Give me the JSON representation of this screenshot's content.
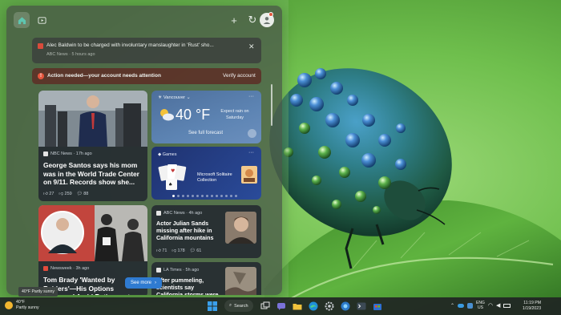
{
  "panel": {
    "notifications": [
      {
        "text": "Alec Baldwin to be charged with involuntary manslaughter in 'Rust' sho...",
        "source": "ABC News · 5 hours ago"
      },
      {
        "text": "Action needed—your account needs attention",
        "action": "Verify account"
      }
    ],
    "cards": {
      "santos": {
        "source": "NBC News · 17h ago",
        "headline": "George Santos says his mom was in the World Trade Center on 9/11. Records show she...",
        "likes": "27",
        "dislikes": "259",
        "comments": "88"
      },
      "brady": {
        "source": "Newsweek · 3h ago",
        "headline": "Tom Brady 'Wanted by Raiders'—His Options Assessed Amid Retirement Rumors"
      },
      "weather": {
        "city": "Vancouver",
        "temp": "40 °F",
        "desc": "Expect rain on Saturday",
        "link": "See full forecast"
      },
      "games": {
        "title": "Games",
        "label": "Microsoft Solitaire Collection"
      },
      "sands": {
        "source": "ABC News · 4h ago",
        "headline": "Actor Julian Sands missing after hike in California mountains",
        "likes": "71",
        "dislikes": "178",
        "comments": "61"
      },
      "latimes": {
        "source": "LA Times · 5h ago",
        "headline": "After pummeling, scientists say California storms were more by..."
      }
    },
    "see_more": "See more"
  },
  "taskbar": {
    "weather_temp": "40°F",
    "weather_desc": "Partly sunny",
    "tooltip": "40°F Partly sunny",
    "search_label": "Search",
    "lang_1": "ENG",
    "lang_2": "US",
    "time": "11:19 PM",
    "date": "1/19/2023"
  },
  "colors": {
    "accent": "#2f7bd1",
    "alert_bg": "#5c3228",
    "wallpaper_green": "#6fbf4d"
  }
}
